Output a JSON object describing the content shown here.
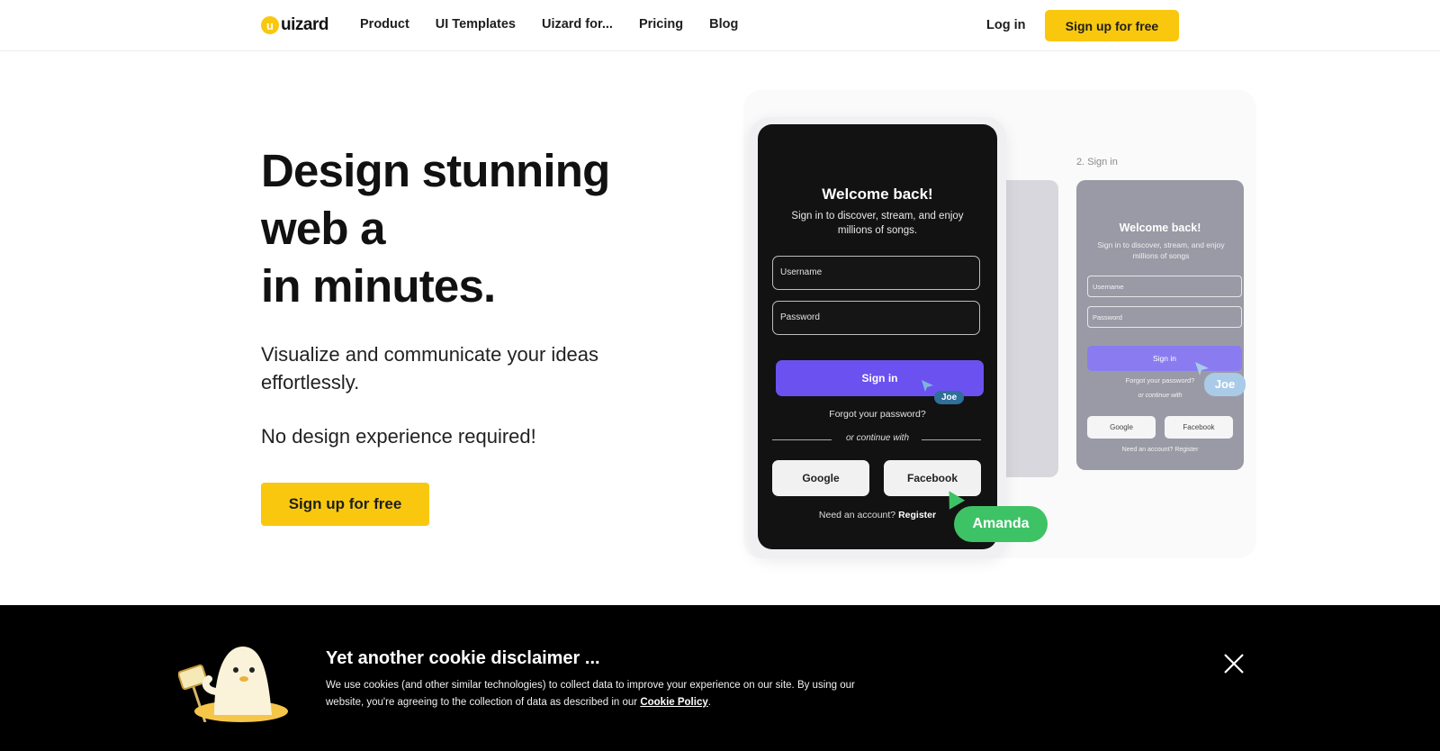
{
  "header": {
    "logo_mark": "u",
    "logo_text": "uizard",
    "nav": [
      "Product",
      "UI Templates",
      "Uizard for...",
      "Pricing",
      "Blog"
    ],
    "login": "Log in",
    "signup": "Sign up for free"
  },
  "hero": {
    "title_lines": [
      "Design stunning",
      "web a",
      "in minutes."
    ],
    "subtitle": "Visualize and communicate your ideas effortlessly.",
    "subtitle2": "No design experience required!",
    "cta": "Sign up for free"
  },
  "illustration": {
    "phone": {
      "title": "Welcome back!",
      "desc": "Sign in to discover, stream, and enjoy millions of songs.",
      "username": "Username",
      "password": "Password",
      "signin": "Sign in",
      "forgot": "Forgot your password?",
      "or": "or continue with",
      "google": "Google",
      "facebook": "Facebook",
      "register_prefix": "Need an account?",
      "register": "Register"
    },
    "cursor_joe": "Joe",
    "cursor_amanda": "Amanda",
    "right_card": {
      "label": "2. Sign in",
      "title": "Welcome back!",
      "desc": "Sign in to discover, stream, and enjoy millions of songs",
      "username": "Username",
      "password": "Password",
      "signin": "Sign in",
      "forgot": "Forgot your password?",
      "or": "or continue with",
      "google": "Google",
      "facebook": "Facebook",
      "register": "Need an account? Register"
    },
    "cursor_joe2": "Joe",
    "colors": {
      "brand_yellow": "#f9c80e",
      "signin_purple": "#6b51f0",
      "amanda_green": "#3ec266"
    }
  },
  "cookie": {
    "title": "Yet another cookie disclaimer ...",
    "text_before": "We use cookies (and other similar technologies) to collect data to improve your experience on our site. By using our website, you're agreeing to the collection of data as described in our ",
    "link": "Cookie Policy",
    "text_after": ".",
    "mascot_icon": "seal-mascot-icon",
    "close_icon": "close-icon"
  }
}
